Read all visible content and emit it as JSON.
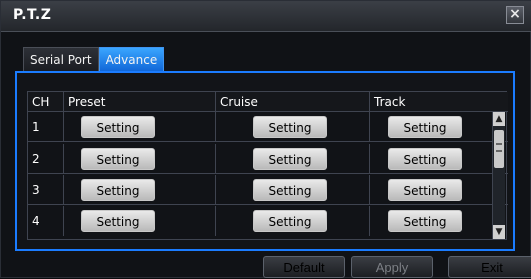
{
  "window": {
    "title": "P.T.Z",
    "close_label": "×"
  },
  "tabs": [
    {
      "label": "Serial Port",
      "active": false
    },
    {
      "label": "Advance",
      "active": true
    }
  ],
  "table": {
    "headers": [
      "CH",
      "Preset",
      "Cruise",
      "Track"
    ],
    "rows": [
      {
        "ch": "1",
        "preset": "Setting",
        "cruise": "Setting",
        "track": "Setting"
      },
      {
        "ch": "2",
        "preset": "Setting",
        "cruise": "Setting",
        "track": "Setting"
      },
      {
        "ch": "3",
        "preset": "Setting",
        "cruise": "Setting",
        "track": "Setting"
      },
      {
        "ch": "4",
        "preset": "Setting",
        "cruise": "Setting",
        "track": "Setting"
      }
    ]
  },
  "scrollbar": {
    "up_icon": "triangle-up-icon",
    "down_icon": "triangle-down-icon"
  },
  "footer": {
    "default_label": "Default",
    "apply_label": "Apply",
    "exit_label": "Exit"
  },
  "colors": {
    "accent": "#1b7cff",
    "active_tab": "#1f86f4"
  }
}
